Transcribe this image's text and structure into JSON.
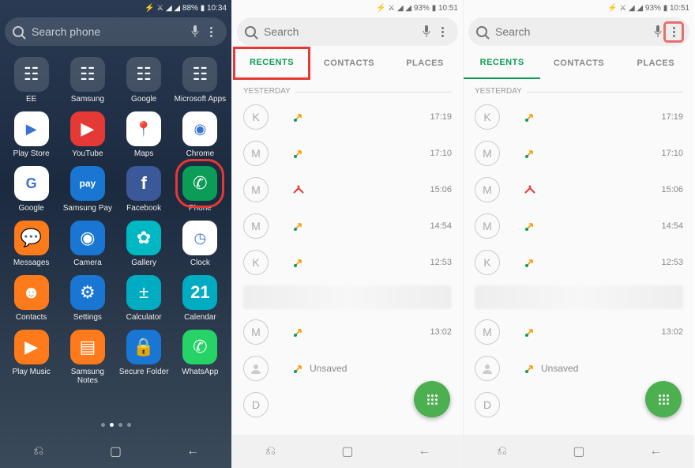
{
  "panel1": {
    "status": {
      "signal": "⚡ ⚔ ◢ ◢ 88% ▮ 10:34"
    },
    "search": {
      "placeholder": "Search phone"
    },
    "apps": [
      {
        "label": "EE",
        "glyph": "☷",
        "cls": "ic-folder",
        "name": "folder-ee"
      },
      {
        "label": "Samsung",
        "glyph": "☷",
        "cls": "ic-folder",
        "name": "folder-samsung"
      },
      {
        "label": "Google",
        "glyph": "☷",
        "cls": "ic-folder",
        "name": "folder-google"
      },
      {
        "label": "Microsoft Apps",
        "glyph": "☷",
        "cls": "ic-folder",
        "name": "folder-microsoft"
      },
      {
        "label": "Play Store",
        "glyph": "▶",
        "cls": "ic-white",
        "name": "app-play-store"
      },
      {
        "label": "YouTube",
        "glyph": "▶",
        "cls": "ic-red",
        "name": "app-youtube"
      },
      {
        "label": "Maps",
        "glyph": "📍",
        "cls": "ic-white",
        "name": "app-maps"
      },
      {
        "label": "Chrome",
        "glyph": "◉",
        "cls": "ic-white",
        "name": "app-chrome"
      },
      {
        "label": "Google",
        "glyph": "G",
        "cls": "ic-white",
        "name": "app-google"
      },
      {
        "label": "Samsung Pay",
        "glyph": "pay",
        "cls": "ic-blue",
        "name": "app-samsung-pay"
      },
      {
        "label": "Facebook",
        "glyph": "f",
        "cls": "ic-fb",
        "name": "app-facebook"
      },
      {
        "label": "Phone",
        "glyph": "✆",
        "cls": "ic-green",
        "name": "app-phone",
        "highlight": true
      },
      {
        "label": "Messages",
        "glyph": "💬",
        "cls": "ic-orange",
        "name": "app-messages"
      },
      {
        "label": "Camera",
        "glyph": "◉",
        "cls": "ic-blue",
        "name": "app-camera"
      },
      {
        "label": "Gallery",
        "glyph": "✿",
        "cls": "ic-teal",
        "name": "app-gallery"
      },
      {
        "label": "Clock",
        "glyph": "◷",
        "cls": "ic-white",
        "name": "app-clock"
      },
      {
        "label": "Contacts",
        "glyph": "☻",
        "cls": "ic-orange",
        "name": "app-contacts"
      },
      {
        "label": "Settings",
        "glyph": "⚙",
        "cls": "ic-blue",
        "name": "app-settings"
      },
      {
        "label": "Calculator",
        "glyph": "±",
        "cls": "ic-cyan",
        "name": "app-calculator"
      },
      {
        "label": "Calendar",
        "glyph": "21",
        "cls": "ic-cyan",
        "name": "app-calendar"
      },
      {
        "label": "Play Music",
        "glyph": "▶",
        "cls": "ic-orange",
        "name": "app-play-music"
      },
      {
        "label": "Samsung Notes",
        "glyph": "▤",
        "cls": "ic-orange",
        "name": "app-samsung-notes"
      },
      {
        "label": "Secure Folder",
        "glyph": "🔒",
        "cls": "ic-blue",
        "name": "app-secure-folder"
      },
      {
        "label": "WhatsApp",
        "glyph": "✆",
        "cls": "ic-wa",
        "name": "app-whatsapp"
      }
    ]
  },
  "panel2": {
    "status": {
      "signal": "⚡ ⚔ ◢ ◢ 93% ▮ 10:51"
    },
    "search": {
      "placeholder": "Search"
    },
    "tabs": [
      {
        "label": "RECENTS",
        "active": true,
        "highlight": true
      },
      {
        "label": "CONTACTS",
        "active": false
      },
      {
        "label": "PLACES",
        "active": false
      }
    ],
    "section": "YESTERDAY",
    "calls": [
      {
        "initial": "K",
        "type": "out",
        "time": "17:19"
      },
      {
        "initial": "M",
        "type": "out",
        "time": "17:10"
      },
      {
        "initial": "M",
        "type": "missed",
        "time": "15:06"
      },
      {
        "initial": "M",
        "type": "out",
        "time": "14:54"
      },
      {
        "initial": "K",
        "type": "out",
        "time": "12:53"
      },
      {
        "blur": true
      },
      {
        "initial": "M",
        "type": "out",
        "time": "13:02"
      },
      {
        "initial": "",
        "label": "Unsaved",
        "type": "out",
        "time": ""
      },
      {
        "initial": "D",
        "type": "",
        "time": ""
      }
    ]
  },
  "panel3": {
    "status": {
      "signal": "⚡ ⚔ ◢ ◢ 93% ▮ 10:51"
    },
    "search": {
      "placeholder": "Search"
    },
    "moreHighlight": true,
    "tabs": [
      {
        "label": "RECENTS",
        "active": true
      },
      {
        "label": "CONTACTS",
        "active": false
      },
      {
        "label": "PLACES",
        "active": false
      }
    ],
    "section": "YESTERDAY",
    "calls": [
      {
        "initial": "K",
        "type": "out",
        "time": "17:19"
      },
      {
        "initial": "M",
        "type": "out",
        "time": "17:10"
      },
      {
        "initial": "M",
        "type": "missed",
        "time": "15:06"
      },
      {
        "initial": "M",
        "type": "out",
        "time": "14:54"
      },
      {
        "initial": "K",
        "type": "out",
        "time": "12:53"
      },
      {
        "blur": true
      },
      {
        "initial": "M",
        "type": "out",
        "time": "13:02"
      },
      {
        "initial": "",
        "label": "Unsaved",
        "type": "out",
        "time": ""
      },
      {
        "initial": "D",
        "type": "",
        "time": ""
      }
    ]
  }
}
